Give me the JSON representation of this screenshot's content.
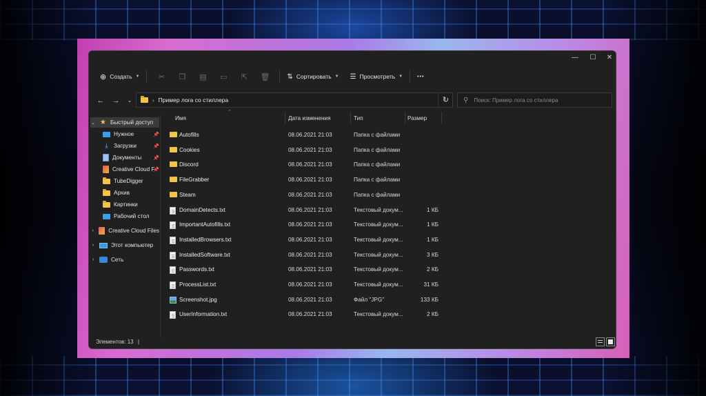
{
  "toolbar": {
    "create_label": "Создать",
    "sort_label": "Сортировать",
    "view_label": "Просмотреть",
    "more_label": "•••"
  },
  "address": {
    "path": "Пример лога со стиллера",
    "search_placeholder": "Поиск: Пример лога со стиллера"
  },
  "sidebar": {
    "quick_access": "Быстрый доступ",
    "items": [
      {
        "label": "Нужное",
        "icon": "blue-folder-icon",
        "pinned": true
      },
      {
        "label": "Загрузки",
        "icon": "download-icon",
        "pinned": true
      },
      {
        "label": "Документы",
        "icon": "documents-icon",
        "pinned": true
      },
      {
        "label": "Creative Cloud F",
        "icon": "creative-cloud-icon",
        "pinned": true
      },
      {
        "label": "TubeDigger",
        "icon": "folder-icon",
        "pinned": false
      },
      {
        "label": "Архив",
        "icon": "folder-icon",
        "pinned": false
      },
      {
        "label": "Картинки",
        "icon": "folder-icon",
        "pinned": false
      },
      {
        "label": "Рабочий стол",
        "icon": "desktop-icon",
        "pinned": false
      }
    ],
    "roots": [
      {
        "label": "Creative Cloud Files",
        "icon": "creative-cloud-icon"
      },
      {
        "label": "Этот компьютер",
        "icon": "computer-icon"
      },
      {
        "label": "Сеть",
        "icon": "network-icon"
      }
    ]
  },
  "columns": {
    "name": "Имя",
    "date": "Дата изменения",
    "type": "Тип",
    "size": "Размер"
  },
  "files": [
    {
      "name": "Autofills",
      "date": "08.06.2021 21:03",
      "type": "Папка с файлами",
      "size": "",
      "icon": "folder-icon"
    },
    {
      "name": "Cookies",
      "date": "08.06.2021 21:03",
      "type": "Папка с файлами",
      "size": "",
      "icon": "folder-icon"
    },
    {
      "name": "Discord",
      "date": "08.06.2021 21:03",
      "type": "Папка с файлами",
      "size": "",
      "icon": "folder-icon"
    },
    {
      "name": "FileGrabber",
      "date": "08.06.2021 21:03",
      "type": "Папка с файлами",
      "size": "",
      "icon": "folder-icon"
    },
    {
      "name": "Steam",
      "date": "08.06.2021 21:03",
      "type": "Папка с файлами",
      "size": "",
      "icon": "folder-icon"
    },
    {
      "name": "DomainDetects.txt",
      "date": "08.06.2021 21:03",
      "type": "Текстовый докум...",
      "size": "1 КБ",
      "icon": "text-file-icon"
    },
    {
      "name": "ImportantAutofills.txt",
      "date": "08.06.2021 21:03",
      "type": "Текстовый докум...",
      "size": "1 КБ",
      "icon": "text-file-icon"
    },
    {
      "name": "InstalledBrowsers.txt",
      "date": "08.06.2021 21:03",
      "type": "Текстовый докум...",
      "size": "1 КБ",
      "icon": "text-file-icon"
    },
    {
      "name": "InstalledSoftware.txt",
      "date": "08.06.2021 21:03",
      "type": "Текстовый докум...",
      "size": "3 КБ",
      "icon": "text-file-icon"
    },
    {
      "name": "Passwords.txt",
      "date": "08.06.2021 21:03",
      "type": "Текстовый докум...",
      "size": "2 КБ",
      "icon": "text-file-icon"
    },
    {
      "name": "ProcessList.txt",
      "date": "08.06.2021 21:03",
      "type": "Текстовый докум...",
      "size": "31 КБ",
      "icon": "text-file-icon"
    },
    {
      "name": "Screenshot.jpg",
      "date": "08.06.2021 21:03",
      "type": "Файл \"JPG\"",
      "size": "133 КБ",
      "icon": "image-file-icon"
    },
    {
      "name": "UserInformation.txt",
      "date": "08.06.2021 21:03",
      "type": "Текстовый докум...",
      "size": "2 КБ",
      "icon": "text-file-icon"
    }
  ],
  "status": {
    "items_text": "Элементов: 13",
    "cursor": "|"
  },
  "colors": {
    "window_bg": "#202020",
    "accent_folder": "#f2c54a",
    "frame_pink": "#c23fb1"
  }
}
